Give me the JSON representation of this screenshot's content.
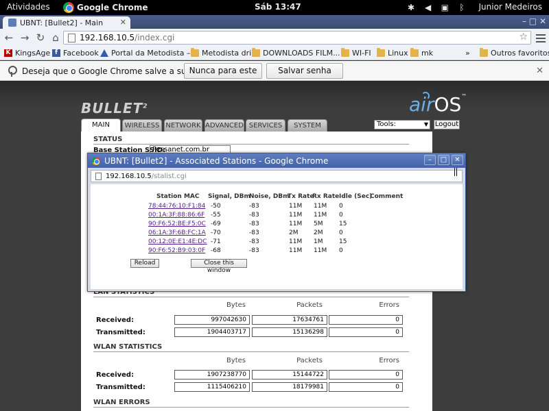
{
  "topbar": {
    "activities": "Atividades",
    "app_name": "Google Chrome",
    "clock": "Sáb 13:47",
    "user": "Junior Medeiros"
  },
  "browser": {
    "tab_title": "UBNT: [Bullet2] - Main",
    "url_host": "192.168.10.5",
    "url_path": "/index.cgi"
  },
  "bookmarks": {
    "items": [
      "KingsAge",
      "Facebook",
      "Portal da Metodista –",
      "Metodista dri",
      "DOWNLOADS FILM...",
      "WI-FI",
      "Linux",
      "mk"
    ],
    "overflow": "»",
    "other": "Outros favoritos"
  },
  "infobar": {
    "message": "Deseja que o Google Chrome salve a sua senha?",
    "never_label": "Nunca para este site",
    "save_label": "Salvar senha"
  },
  "device": {
    "brand": "BULLET",
    "brand_sup": "2",
    "logo_air": "air",
    "logo_os": "OS",
    "logo_tm": "™",
    "tabs": [
      "MAIN",
      "WIRELESS",
      "NETWORK",
      "ADVANCED",
      "SERVICES",
      "SYSTEM"
    ],
    "tools_label": "Tools:",
    "logout_label": "Logout",
    "status_title": "STATUS",
    "ssid_label": "Base Station SSID:",
    "ssid_value": "Pessanet.com.br",
    "lan_title": "LAN STATISTICS",
    "wlan_title": "WLAN STATISTICS",
    "wlan_errors_title": "WLAN ERRORS",
    "col_bytes": "Bytes",
    "col_packets": "Packets",
    "col_errors": "Errors",
    "row_received": "Received:",
    "row_transmitted": "Transmitted:",
    "lan": {
      "received": {
        "bytes": "997042630",
        "packets": "17634761",
        "errors": "0"
      },
      "transmitted": {
        "bytes": "1904403717",
        "packets": "15136298",
        "errors": "0"
      }
    },
    "wlan": {
      "received": {
        "bytes": "1907238770",
        "packets": "15144722",
        "errors": "0"
      },
      "transmitted": {
        "bytes": "1115406210",
        "packets": "18179981",
        "errors": "0"
      }
    }
  },
  "popup": {
    "title": "UBNT: [Bullet2] - Associated Stations - Google Chrome",
    "url_host": "192.168.10.5",
    "url_path": "/stalist.cgi",
    "headers": [
      "Station MAC",
      "Signal, DBm",
      "Noise, DBm",
      "Tx Rate",
      "Rx Rate",
      "Idle (Sec)",
      "Comment"
    ],
    "stations": [
      {
        "mac": "78:44:76:10:F1:84",
        "signal": "-50",
        "noise": "-83",
        "tx": "11M",
        "rx": "11M",
        "idle": "0"
      },
      {
        "mac": "00:1A:3F:88:86:6F",
        "signal": "-55",
        "noise": "-83",
        "tx": "11M",
        "rx": "11M",
        "idle": "0"
      },
      {
        "mac": "90:F6:52:BE:F5:0C",
        "signal": "-69",
        "noise": "-83",
        "tx": "11M",
        "rx": "5M",
        "idle": "15"
      },
      {
        "mac": "06:1A:3F:6B:FC:1A",
        "signal": "-70",
        "noise": "-83",
        "tx": "2M",
        "rx": "2M",
        "idle": "0"
      },
      {
        "mac": "00:12:0E:E1:4E:DC",
        "signal": "-71",
        "noise": "-83",
        "tx": "11M",
        "rx": "1M",
        "idle": "15"
      },
      {
        "mac": "90:F6:52:B9:03:0F",
        "signal": "-68",
        "noise": "-83",
        "tx": "11M",
        "rx": "11M",
        "idle": "0"
      }
    ],
    "reload_label": "Reload",
    "close_label": "Close this window"
  }
}
